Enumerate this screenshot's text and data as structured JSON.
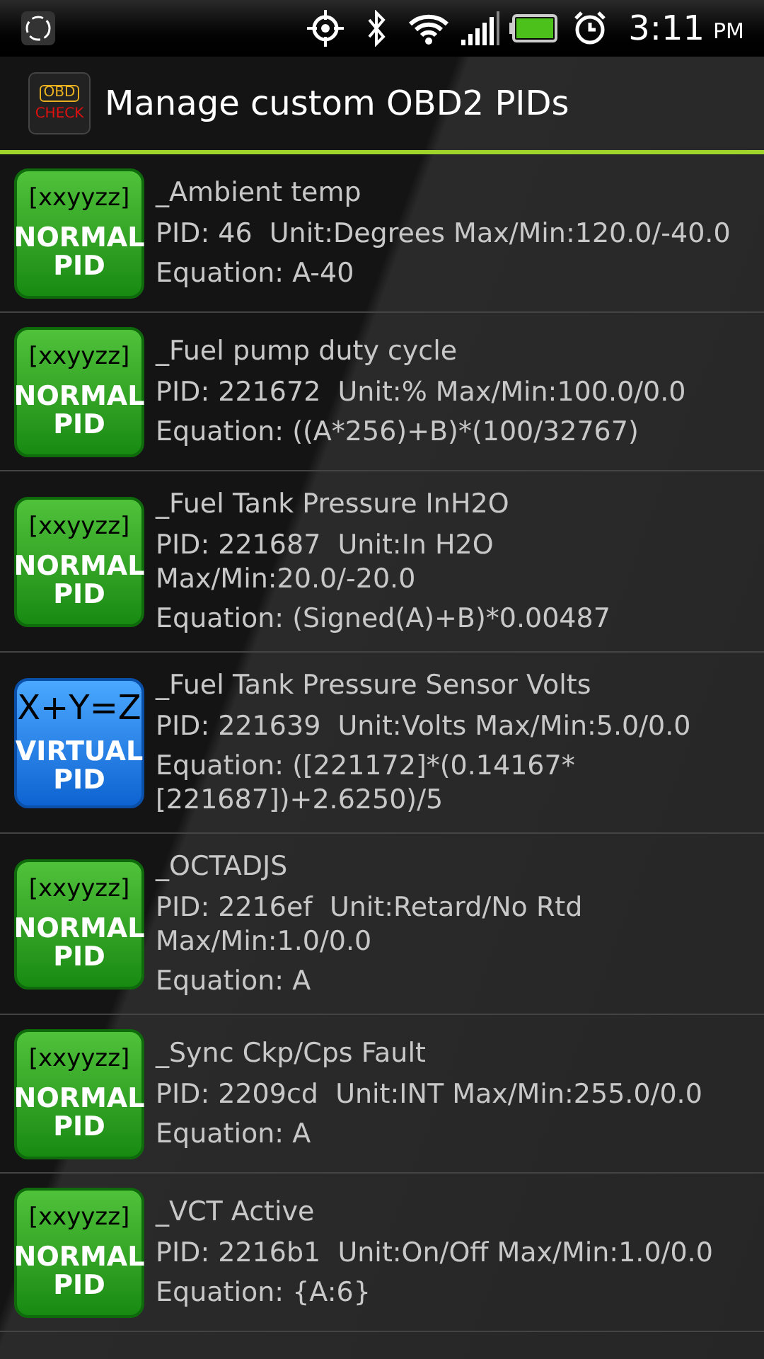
{
  "status_bar": {
    "time": "3:11",
    "ampm": "PM"
  },
  "header": {
    "logo_top": "OBD",
    "logo_bottom": "CHECK",
    "title": "Manage custom OBD2 PIDs"
  },
  "pids": [
    {
      "kind": "normal",
      "symbol": "[xxyyzz]",
      "badge_line1": "NORMAL",
      "badge_line2": "PID",
      "name": "_Ambient temp",
      "details": "PID: 46  Unit:Degrees Max/Min:120.0/-40.0",
      "equation": "Equation: A-40"
    },
    {
      "kind": "normal",
      "symbol": "[xxyyzz]",
      "badge_line1": "NORMAL",
      "badge_line2": "PID",
      "name": "_Fuel pump duty cycle",
      "details": "PID: 221672  Unit:% Max/Min:100.0/0.0",
      "equation": "Equation: ((A*256)+B)*(100/32767)"
    },
    {
      "kind": "normal",
      "symbol": "[xxyyzz]",
      "badge_line1": "NORMAL",
      "badge_line2": "PID",
      "name": "_Fuel Tank Pressure InH2O",
      "details": "PID: 221687  Unit:In H2O Max/Min:20.0/-20.0",
      "equation": "Equation: (Signed(A)+B)*0.00487"
    },
    {
      "kind": "virtual",
      "symbol": "X+Y=Z",
      "badge_line1": "VIRTUAL",
      "badge_line2": "PID",
      "name": "_Fuel Tank Pressure Sensor Volts",
      "details": "PID: 221639  Unit:Volts Max/Min:5.0/0.0",
      "equation": "Equation: ([221172]*(0.14167*[221687])+2.6250)/5"
    },
    {
      "kind": "normal",
      "symbol": "[xxyyzz]",
      "badge_line1": "NORMAL",
      "badge_line2": "PID",
      "name": "_OCTADJS",
      "details": "PID: 2216ef  Unit:Retard/No Rtd Max/Min:1.0/0.0",
      "equation": "Equation: A"
    },
    {
      "kind": "normal",
      "symbol": "[xxyyzz]",
      "badge_line1": "NORMAL",
      "badge_line2": "PID",
      "name": "_Sync Ckp/Cps Fault",
      "details": "PID: 2209cd  Unit:INT Max/Min:255.0/0.0",
      "equation": "Equation: A"
    },
    {
      "kind": "normal",
      "symbol": "[xxyyzz]",
      "badge_line1": "NORMAL",
      "badge_line2": "PID",
      "name": "_VCT Active",
      "details": "PID: 2216b1  Unit:On/Off Max/Min:1.0/0.0",
      "equation": "Equation: {A:6}"
    }
  ]
}
